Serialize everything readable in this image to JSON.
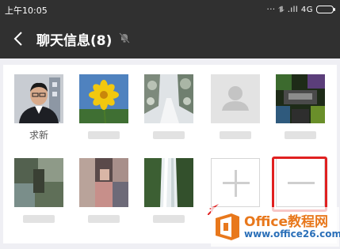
{
  "status_bar": {
    "time": "上午10:05",
    "network": "··· ⥮ .ıll 4G"
  },
  "nav": {
    "title": "聊天信息(8)"
  },
  "members": [
    {
      "name": "求新"
    },
    {
      "name": ""
    },
    {
      "name": ""
    },
    {
      "name": ""
    },
    {
      "name": ""
    },
    {
      "name": ""
    },
    {
      "name": ""
    },
    {
      "name": ""
    }
  ],
  "watermark": {
    "title": "Office教程网",
    "url": "www.office26.com"
  },
  "colors": {
    "header": "#303030",
    "highlight": "#e02020",
    "watermark_orange": "#e8781c",
    "watermark_blue": "#2a6fb8"
  }
}
